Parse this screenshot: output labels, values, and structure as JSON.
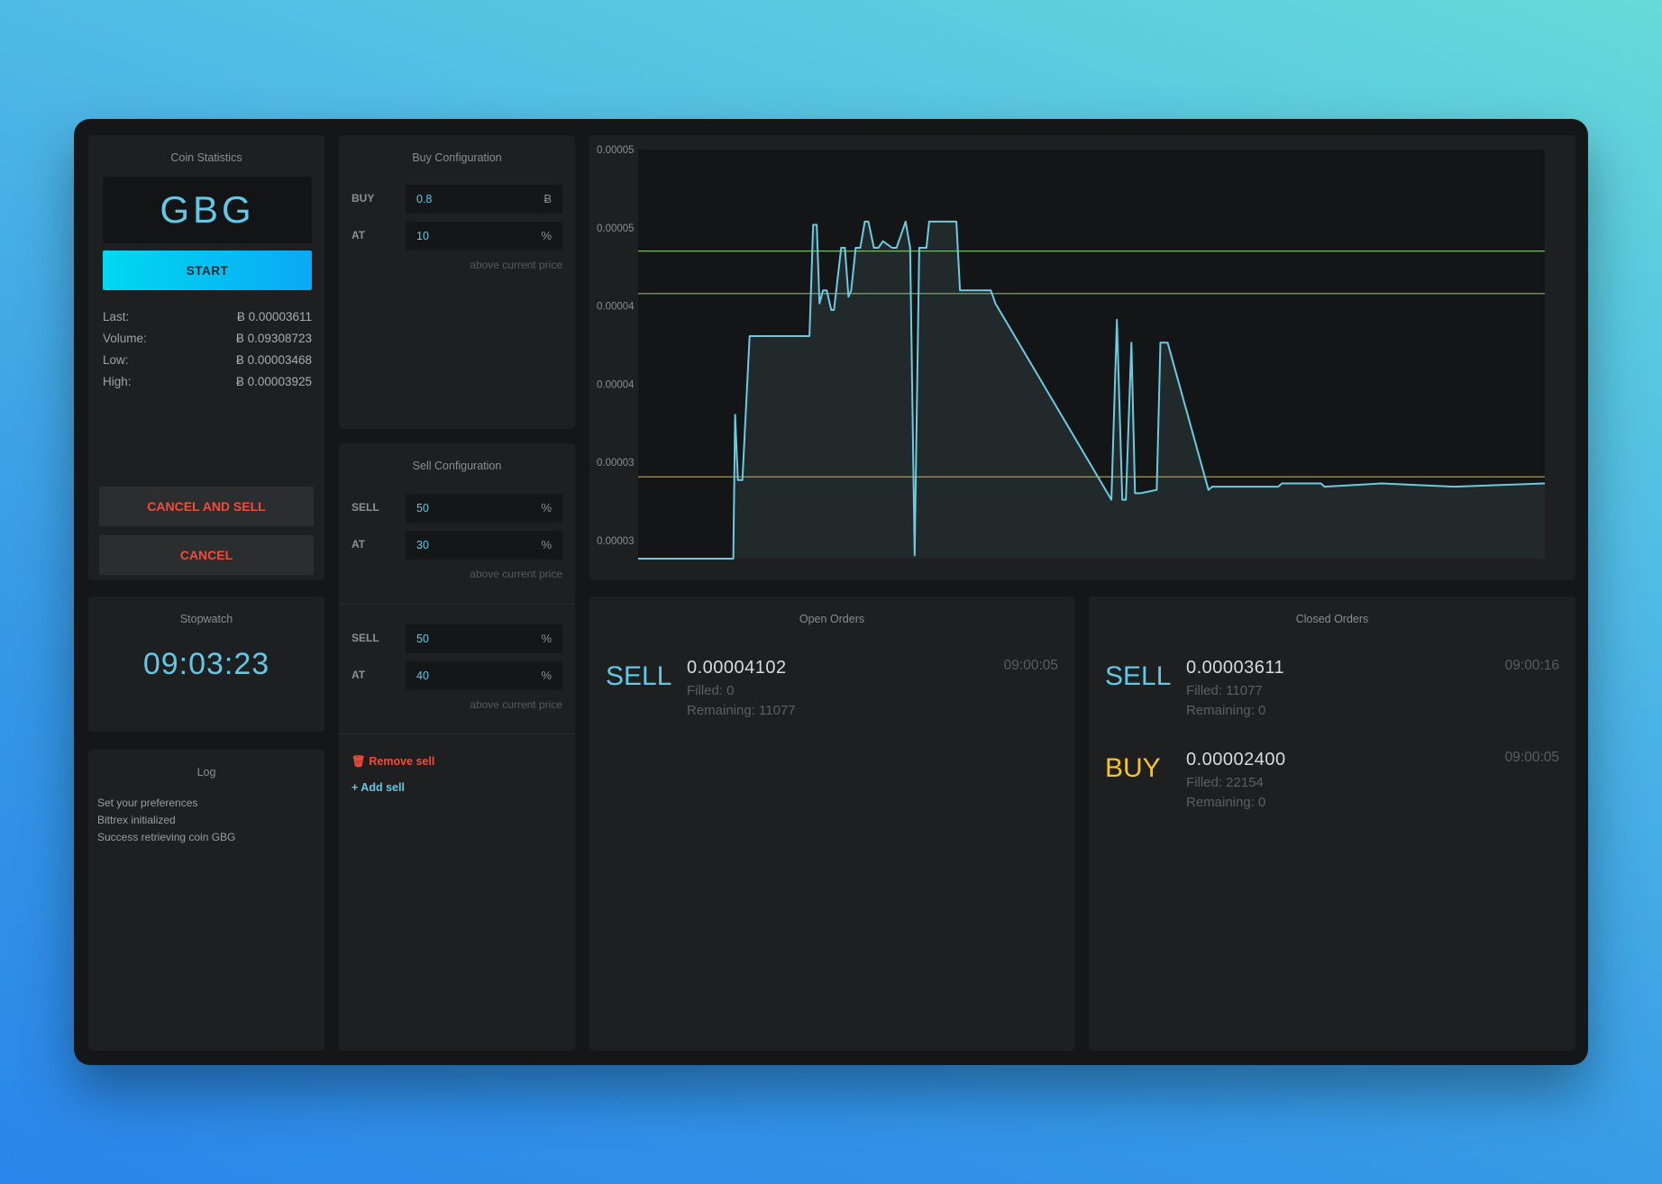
{
  "coin_stats": {
    "title": "Coin Statistics",
    "coin": "GBG",
    "start_label": "START",
    "stats": [
      {
        "label": "Last:",
        "value": "Ƀ 0.00003611"
      },
      {
        "label": "Volume:",
        "value": "Ƀ 0.09308723"
      },
      {
        "label": "Low:",
        "value": "Ƀ 0.00003468"
      },
      {
        "label": "High:",
        "value": "Ƀ 0.00003925"
      }
    ],
    "cancel_sell_label": "CANCEL AND SELL",
    "cancel_label": "CANCEL"
  },
  "stopwatch": {
    "title": "Stopwatch",
    "time": "09:03:23"
  },
  "log": {
    "title": "Log",
    "lines": [
      "Set your preferences",
      "Bittrex initialized",
      "Success retrieving coin GBG"
    ]
  },
  "buy_config": {
    "title": "Buy Configuration",
    "buy_label": "BUY",
    "buy_value": "0.8",
    "buy_unit": "Ƀ",
    "at_label": "AT",
    "at_value": "10",
    "at_unit": "%",
    "hint": "above current price"
  },
  "sell_config": {
    "title": "Sell Configuration",
    "sells": [
      {
        "sell_label": "SELL",
        "sell_value": "50",
        "sell_unit": "%",
        "at_label": "AT",
        "at_value": "30",
        "at_unit": "%",
        "hint": "above current price"
      },
      {
        "sell_label": "SELL",
        "sell_value": "50",
        "sell_unit": "%",
        "at_label": "AT",
        "at_value": "40",
        "at_unit": "%",
        "hint": "above current price"
      }
    ],
    "remove_label": "Remove sell",
    "add_label": "+ Add sell"
  },
  "chart_data": {
    "type": "area",
    "y_tick_labels": [
      "0.00005",
      "0.00005",
      "0.00004",
      "0.00004",
      "0.00003",
      "0.00003"
    ],
    "ylim": [
      3e-05,
      4.25e-05
    ],
    "x": [
      0,
      10.5,
      10.7,
      11,
      11.5,
      12.3,
      18.9,
      19.3,
      19.7,
      20,
      20.4,
      20.8,
      21.3,
      21.6,
      22.4,
      22.8,
      23.2,
      23.5,
      24,
      24.5,
      25,
      25.4,
      26,
      26.5,
      27,
      28,
      28.5,
      29.5,
      30,
      30.5,
      31,
      31.4,
      31.8,
      32.1,
      35.1,
      35.5,
      38.9,
      39.4,
      52.2,
      52.8,
      53.4,
      53.8,
      54.4,
      54.8,
      55.4,
      57.2,
      57.6,
      58,
      58.4,
      62.9,
      63.3,
      70.6,
      71,
      75.3,
      75.7,
      82,
      90,
      100
    ],
    "series": [
      {
        "color": "#6ccbe0",
        "values": [
          3e-05,
          3e-05,
          3.44e-05,
          3.24e-05,
          3.24e-05,
          3.68e-05,
          3.68e-05,
          4.02e-05,
          4.02e-05,
          3.78e-05,
          3.82e-05,
          3.82e-05,
          3.76e-05,
          3.76e-05,
          3.95e-05,
          3.95e-05,
          3.8e-05,
          3.82e-05,
          3.95e-05,
          3.95e-05,
          4.03e-05,
          4.03e-05,
          3.95e-05,
          3.95e-05,
          3.97e-05,
          3.95e-05,
          3.95e-05,
          4.03e-05,
          3.95e-05,
          3.01e-05,
          3.95e-05,
          3.95e-05,
          3.95e-05,
          4.03e-05,
          4.03e-05,
          3.82e-05,
          3.82e-05,
          3.78e-05,
          3.18e-05,
          3.73e-05,
          3.18e-05,
          3.18e-05,
          3.66e-05,
          3.2e-05,
          3.2e-05,
          3.21e-05,
          3.66e-05,
          3.66e-05,
          3.66e-05,
          3.21e-05,
          3.22e-05,
          3.22e-05,
          3.23e-05,
          3.23e-05,
          3.22e-05,
          3.23e-05,
          3.22e-05,
          3.23e-05
        ]
      }
    ],
    "hlines": [
      {
        "y": 3.94e-05,
        "color": "#7db86a"
      },
      {
        "y": 3.81e-05,
        "color": "#7db86a"
      },
      {
        "y": 3.25e-05,
        "color": "#c8a83c"
      }
    ]
  },
  "open_orders": {
    "title": "Open Orders",
    "orders": [
      {
        "type": "SELL",
        "price": "0.00004102",
        "filled": "Filled: 0",
        "remaining": "Remaining: 11077",
        "time": "09:00:05",
        "color": "#63c7e6"
      }
    ]
  },
  "closed_orders": {
    "title": "Closed Orders",
    "orders": [
      {
        "type": "SELL",
        "price": "0.00003611",
        "filled": "Filled: 11077",
        "remaining": "Remaining: 0",
        "time": "09:00:16",
        "color": "#63c7e6"
      },
      {
        "type": "BUY",
        "price": "0.00002400",
        "filled": "Filled: 22154",
        "remaining": "Remaining: 0",
        "time": "09:00:05",
        "color": "#f5c232"
      }
    ]
  }
}
